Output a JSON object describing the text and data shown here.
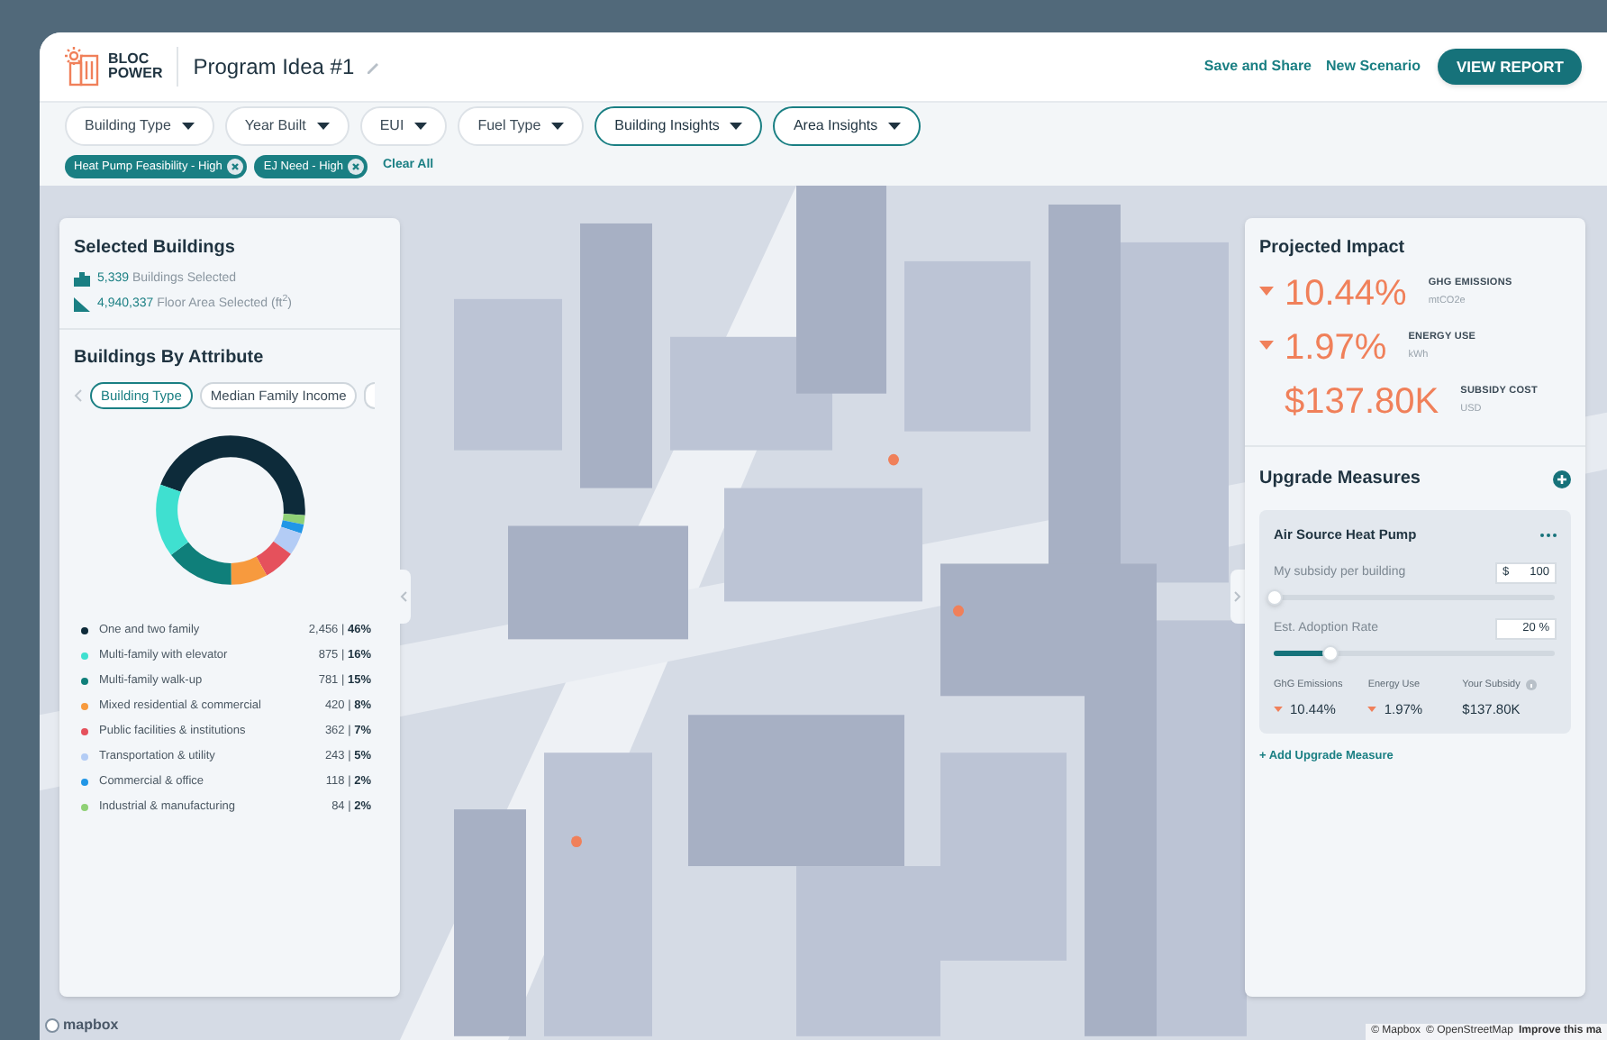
{
  "header": {
    "logo_text": [
      "BLOC",
      "POWER"
    ],
    "title": "Program Idea #1",
    "links": [
      "Save and Share",
      "New Scenario"
    ],
    "primary_button": "VIEW REPORT"
  },
  "filters": [
    {
      "label": "Building Type",
      "emphasized": false
    },
    {
      "label": "Year Built",
      "emphasized": false
    },
    {
      "label": "EUI",
      "emphasized": false
    },
    {
      "label": "Fuel Type",
      "emphasized": false
    },
    {
      "label": "Building Insights",
      "emphasized": true
    },
    {
      "label": "Area Insights",
      "emphasized": true
    }
  ],
  "active_chips": [
    "Heat Pump Feasibility - High",
    "EJ Need - High"
  ],
  "clear_all": "Clear All",
  "selected_buildings": {
    "title": "Selected Buildings",
    "stats": [
      {
        "kind": "count",
        "value": "5,339",
        "label": "Buildings Selected"
      },
      {
        "kind": "area",
        "value": "4,940,337",
        "label": "Floor Area Selected (ft$^{2}$)"
      }
    ]
  },
  "attribute_panel": {
    "title": "Buildings By Attribute",
    "tabs": [
      {
        "label": "Building Type",
        "selected": true
      },
      {
        "label": "Median Family Income",
        "selected": false
      }
    ],
    "chart_data": {
      "type": "donut",
      "categories": [
        "One and two family",
        "Multi-family with elevator",
        "Multi-family walk-up",
        "Mixed residential & commercial",
        "Public facilities & institutions",
        "Transportation & utility",
        "Commercial & office",
        "Industrial & manufacturing"
      ],
      "values": [
        46,
        16,
        15,
        8,
        7,
        5,
        2,
        2
      ]
    },
    "legend": [
      {
        "value_text": "2,456 | **46%**",
        "color": "#0d2b3a"
      },
      {
        "value_text": "875 | **16%**",
        "color": "#3fe0d0"
      },
      {
        "value_text": "781 | **15%**",
        "color": "#0f7f7a"
      },
      {
        "value_text": "420 | **8%**",
        "color": "#f79a3e"
      },
      {
        "value_text": "362 | **7%**",
        "color": "#e5515c"
      },
      {
        "value_text": "243 | **5%**",
        "color": "#b3ccf5"
      },
      {
        "value_text": "118 | **2%**",
        "color": "#2196e6"
      },
      {
        "value_text": "84 | **2%**",
        "color": "#8fd176"
      }
    ]
  },
  "projected_impact": {
    "title": "Projected Impact",
    "metrics": [
      {
        "value": "10.44%",
        "label": "GHG EMISSIONS",
        "unit": "mtCO2e",
        "decrease": true
      },
      {
        "value": "1.97%",
        "label": "ENERGY USE",
        "unit": "kWh",
        "decrease": true
      },
      {
        "value": "$137.80K",
        "label": "SUBSIDY COST",
        "unit": "USD",
        "decrease": false
      }
    ]
  },
  "upgrade_measures": {
    "title": "Upgrade Measures",
    "cards": [
      {
        "title": "Air Source Heat Pump",
        "inputs": [
          {
            "label": "My subsidy per building",
            "prefix": "$",
            "value": "100",
            "level": 0
          },
          {
            "label": "Est. Adoption Rate",
            "value": "20",
            "suffix": "%",
            "level": 0.2
          }
        ],
        "results": [
          {
            "label": "GhG Emissions",
            "value": "10.44%",
            "decrease": true,
            "info": false
          },
          {
            "label": "Energy Use",
            "value": "1.97%",
            "decrease": true,
            "info": false
          },
          {
            "label": "Your Subsidy",
            "value": "$137.80K",
            "decrease": false,
            "info": true
          }
        ]
      }
    ],
    "add_link": "+ Add Upgrade Measure"
  },
  "map": {
    "kind": "picture",
    "logo": "mapbox",
    "attribution": [
      "© Mapbox",
      "© OpenStreetMap",
      "Improve this ma"
    ]
  }
}
